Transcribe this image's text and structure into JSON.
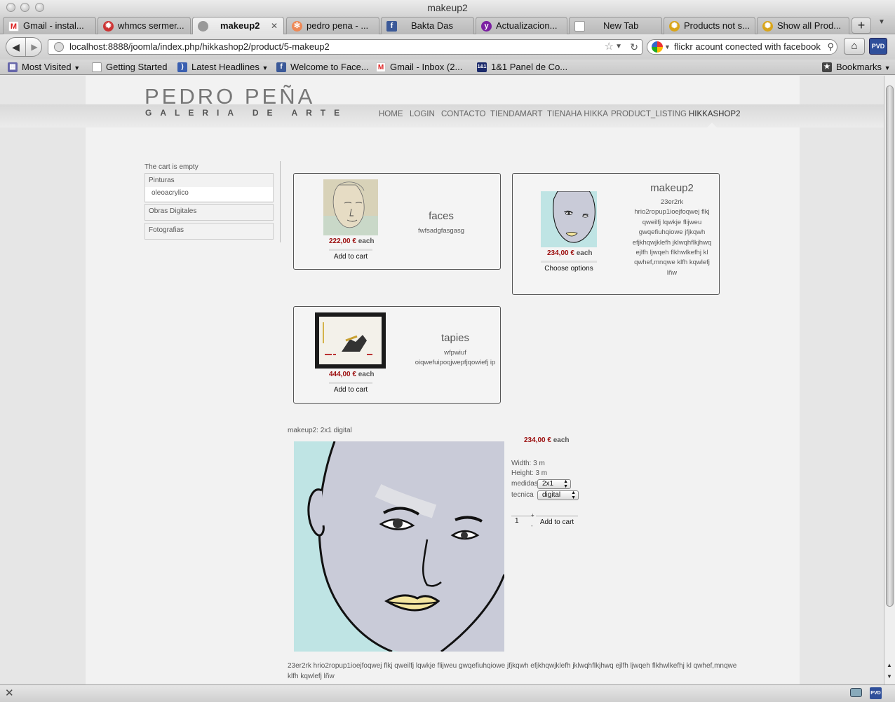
{
  "window": {
    "title": "makeup2"
  },
  "tabs": [
    {
      "label": "Gmail - instal...",
      "icon": "gmail-icon"
    },
    {
      "label": "whmcs sermer...",
      "icon": "gear-icon"
    },
    {
      "label": "makeup2",
      "icon": "globe-icon",
      "active": true
    },
    {
      "label": "pedro pena - ...",
      "icon": "joomla-icon"
    },
    {
      "label": "Bakta Das",
      "icon": "facebook-icon"
    },
    {
      "label": "Actualizacion...",
      "icon": "yahoo-icon"
    },
    {
      "label": "New Tab",
      "icon": "page-icon"
    },
    {
      "label": "Products not s...",
      "icon": "hikashop-icon"
    },
    {
      "label": "Show all Prod...",
      "icon": "hikashop-icon"
    }
  ],
  "nav": {
    "url": "localhost:8888/joomla/index.php/hikkashop2/product/5-makeup2",
    "search": "flickr acount conected with facebook"
  },
  "bookmarks": [
    {
      "label": "Most Visited",
      "icon": "most-visited-icon",
      "dropdown": true
    },
    {
      "label": "Getting Started",
      "icon": "page-icon"
    },
    {
      "label": "Latest Headlines",
      "icon": "rss-icon",
      "dropdown": true
    },
    {
      "label": "Welcome to Face...",
      "icon": "facebook-icon"
    },
    {
      "label": "Gmail - Inbox (2...",
      "icon": "gmail-icon"
    },
    {
      "label": "1&1 Panel de Co...",
      "icon": "oneandone-icon"
    }
  ],
  "bookmarks_menu": "Bookmarks",
  "site": {
    "logo_line1": "PEDRO PEÑA",
    "logo_line2": "GALERIA DE ARTE",
    "menu": [
      "HOME",
      "LOGIN",
      "CONTACTO",
      "TIENDAMART",
      "TIENAHA HIKKA",
      "PRODUCT_LISTING",
      "HIKKASHOP2"
    ],
    "active_menu": "HIKKASHOP2"
  },
  "sidebar": {
    "cart_status": "The cart is empty",
    "categories": [
      {
        "label": "Pinturas",
        "sub": "oleoacrylico"
      },
      {
        "label": "Obras Digitales"
      },
      {
        "label": "Fotografias"
      }
    ]
  },
  "products": [
    {
      "name": "faces",
      "desc": "fwfsadgfasgasg",
      "price": "222,00 €",
      "each": "each",
      "action": "Add to cart"
    },
    {
      "name": "makeup2",
      "desc": "23er2rk hrio2ropup1ioejfoqwej flkj qweilfj lqwkje flijweu gwqefiuhqiowe jfjkqwh efjkhqwjklefh jklwqhflkjhwq ejlfh ljwqeh flkhwlkefhj kl qwhef,mnqwe klfh kqwlefj lñw",
      "price": "234,00 €",
      "each": "each",
      "action": "Choose options"
    },
    {
      "name": "tapies",
      "desc": "wfpwiuf oiqwefuipoqjwepfjqowiefj ip",
      "price": "444,00 €",
      "each": "each",
      "action": "Add to cart"
    }
  ],
  "detail": {
    "label": "makeup2: 2x1 digital",
    "price": "234,00 €",
    "each": "each",
    "width": "Width: 3 m",
    "height": "Height: 3 m",
    "medidas_label": "medidas",
    "medidas_value": "2x1",
    "tecnica_label": "tecnica",
    "tecnica_value": "digital",
    "qty": "1",
    "add_label": "Add to cart",
    "description": "23er2rk hrio2ropup1ioejfoqwej flkj qweilfj lqwkje flijweu gwqefiuhqiowe jfjkqwh efjkhqwjklefh jklwqhflkjhwq ejlfh ljwqeh flkhwlkefhj kl qwhef,mnqwe klfh kqwlefj lñw"
  },
  "colors": {
    "price": "#9b0c0c",
    "accent_facebook": "#3b5998",
    "gmail": "#d44"
  }
}
